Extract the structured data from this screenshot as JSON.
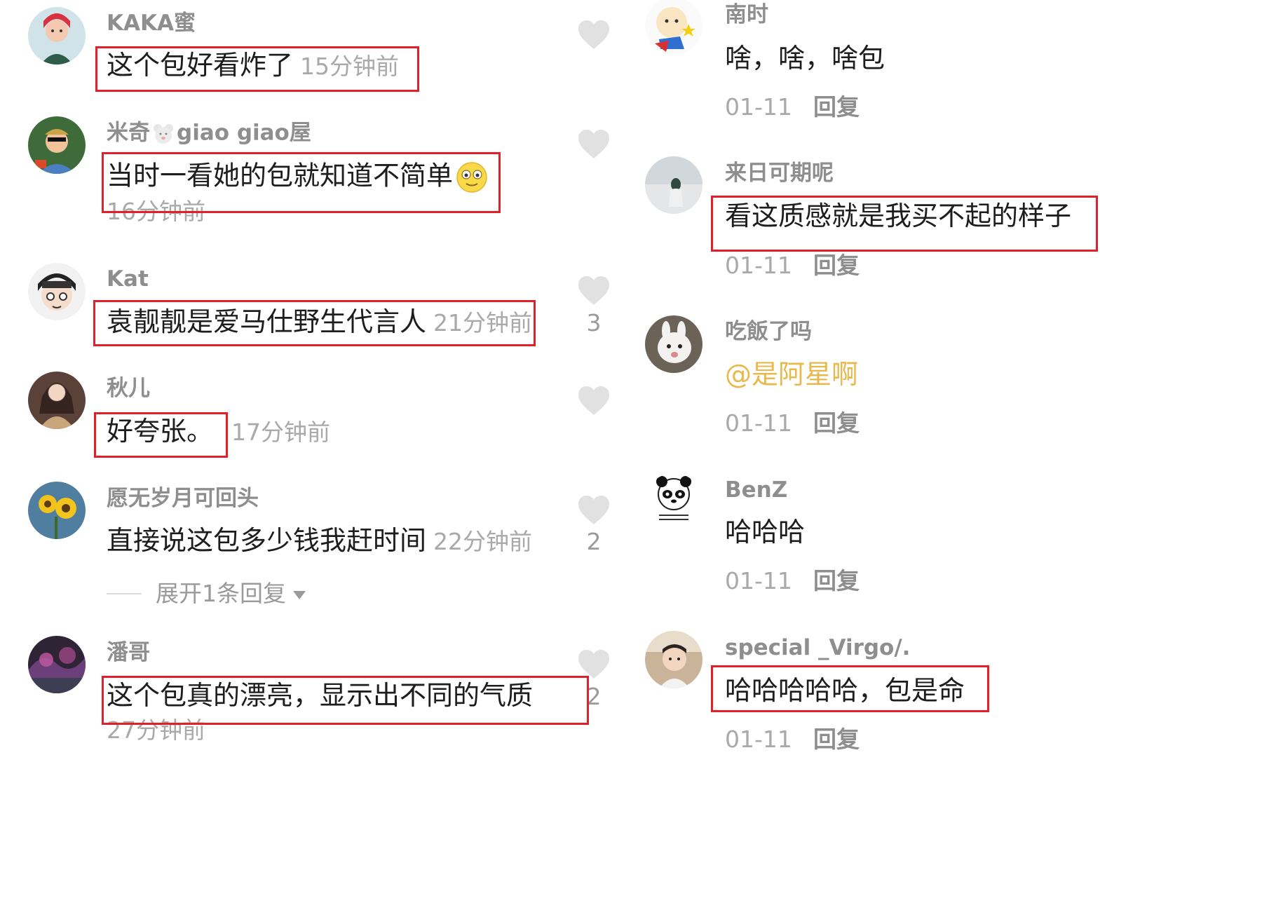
{
  "left_comments": [
    {
      "username": "KAKA蜜",
      "text": "这个包好看炸了",
      "time": "15分钟前",
      "likes": ""
    },
    {
      "username_a": "米奇",
      "username_b": "giao giao屋",
      "text": "当时一看她的包就知道不简单",
      "time": "16分钟前",
      "likes": ""
    },
    {
      "username": "Kat",
      "text": "袁靓靓是爱马仕野生代言人",
      "time": "21分钟前",
      "likes": "3"
    },
    {
      "username": "秋儿",
      "text": "好夸张。",
      "time": "17分钟前",
      "likes": ""
    },
    {
      "username": "愿无岁月可回头",
      "text": "直接说这包多少钱我赶时间",
      "time": "22分钟前",
      "likes": "2",
      "expand": "展开1条回复"
    },
    {
      "username": "潘哥",
      "text": "这个包真的漂亮，显示出不同的气质",
      "time": "27分钟前",
      "likes": "2"
    }
  ],
  "right_comments": [
    {
      "username": "南时",
      "text": "啥，啥，啥包",
      "date": "01-11",
      "reply": "回复"
    },
    {
      "username": "来日可期呢",
      "text": "看这质感就是我买不起的样子",
      "date": "01-11",
      "reply": "回复"
    },
    {
      "username": "吃飯了吗",
      "text": "@是阿星啊",
      "date": "01-11",
      "reply": "回复"
    },
    {
      "username": "BenZ",
      "text": "哈哈哈",
      "date": "01-11",
      "reply": "回复"
    },
    {
      "username": "special _Virgo/.",
      "text": "哈哈哈哈哈，包是命",
      "date": "01-11",
      "reply": "回复"
    }
  ],
  "colors": {
    "highlight_box": "#e3202a",
    "username": "#8e8e8e",
    "comment_text": "#1d1d1d",
    "timestamp": "#a9a9a9",
    "mention": "#e8b84b",
    "heart": "#e1e1e1"
  },
  "icons": [
    "heart-icon",
    "smile-emoji-icon",
    "bear-emoji-icon",
    "chevron-down-icon"
  ]
}
